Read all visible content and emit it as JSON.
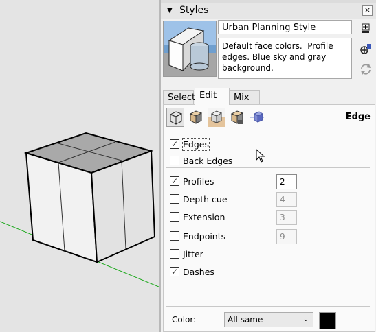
{
  "panel": {
    "title": "Styles",
    "close_glyph": "×",
    "collapse_glyph": "▼"
  },
  "style": {
    "name": "Urban Planning Style",
    "description": "Default face colors.  Profile edges. Blue sky and gray background."
  },
  "tabs": [
    {
      "label": "Select",
      "active": false
    },
    {
      "label": "Edit",
      "active": true
    },
    {
      "label": "Mix",
      "active": false
    }
  ],
  "toolbar": {
    "tools": [
      "edge-settings-icon",
      "face-settings-icon",
      "background-settings-icon",
      "watermark-settings-icon",
      "modeling-settings-icon"
    ],
    "section_label": "Edge"
  },
  "edge_options": [
    {
      "label": "Edges",
      "checked": true
    },
    {
      "label": "Back Edges",
      "checked": false
    },
    {
      "label": "Profiles",
      "checked": true,
      "value": "2",
      "enabled": true
    },
    {
      "label": "Depth cue",
      "checked": false,
      "value": "4",
      "enabled": false
    },
    {
      "label": "Extension",
      "checked": false,
      "value": "3",
      "enabled": false
    },
    {
      "label": "Endpoints",
      "checked": false,
      "value": "9",
      "enabled": false
    },
    {
      "label": "Jitter",
      "checked": false
    },
    {
      "label": "Dashes",
      "checked": true
    }
  ],
  "color": {
    "label": "Color:",
    "selected": "All same",
    "swatch": "#000000"
  },
  "colors": {
    "viewport_bg": "#e4e4e4",
    "ground_axis": "#1aa81a",
    "cube_top": "#a9a9a9",
    "cube_front": "#f2f2f2",
    "cube_side": "#e2e2e2"
  }
}
